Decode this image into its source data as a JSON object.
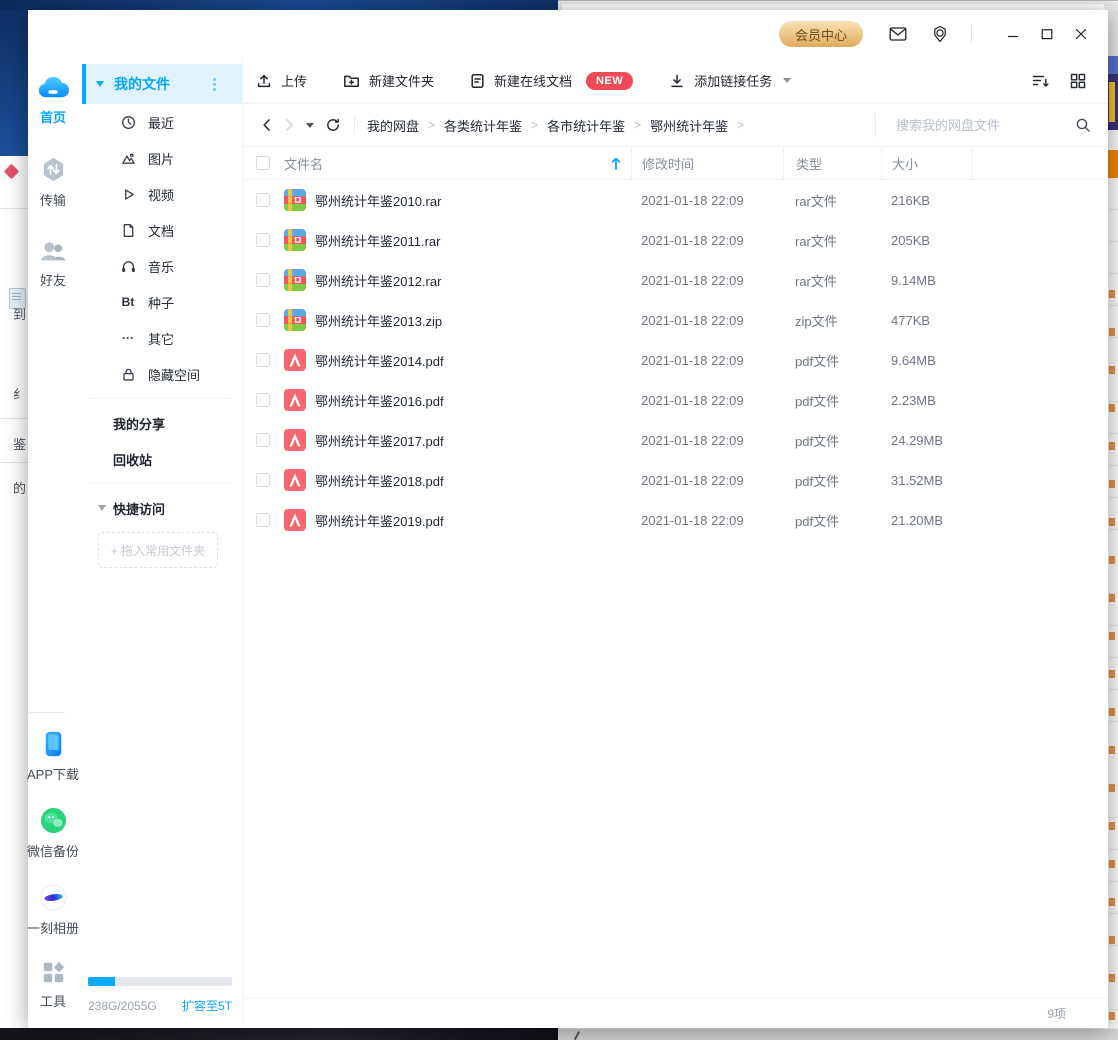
{
  "colors": {
    "accent_blue": "#06a7ff",
    "member_gold_from": "#f8e2b6",
    "member_gold_to": "#e0ab5c",
    "member_text": "#6e4a16",
    "new_badge_red": "#ef4b56",
    "selected_bg": "#e0f3fe",
    "meta_text": "#6f7784"
  },
  "titlebar": {
    "member_center": "会员中心"
  },
  "rail": {
    "items": [
      {
        "label": "首页",
        "icon": "cloud-home-icon",
        "active": true
      },
      {
        "label": "传输",
        "icon": "transfer-icon",
        "active": false
      },
      {
        "label": "好友",
        "icon": "friends-icon",
        "active": false
      }
    ],
    "bottom_items": [
      {
        "label": "APP下载",
        "icon": "phone-app-icon"
      },
      {
        "label": "微信备份",
        "icon": "wechat-backup-icon"
      },
      {
        "label": "一刻相册",
        "icon": "photo-album-icon"
      },
      {
        "label": "工具",
        "icon": "tools-icon"
      }
    ]
  },
  "sidebar": {
    "my_files": "我的文件",
    "items": [
      {
        "label": "最近",
        "icon": "clock-icon"
      },
      {
        "label": "图片",
        "icon": "image-icon"
      },
      {
        "label": "视频",
        "icon": "video-icon"
      },
      {
        "label": "文档",
        "icon": "document-icon"
      },
      {
        "label": "音乐",
        "icon": "music-icon"
      },
      {
        "label": "种子",
        "icon": "bt-icon"
      },
      {
        "label": "其它",
        "icon": "more-dots-icon"
      },
      {
        "label": "隐藏空间",
        "icon": "lock-icon"
      }
    ],
    "icon_glyphs": {
      "bt": "Bt",
      "more": "···"
    },
    "shares": "我的分享",
    "recycle": "回收站",
    "quick_access": "快捷访问",
    "drop_hint": "+ 拖入常用文件夹",
    "storage": {
      "usage": "238G/2055G",
      "upgrade": "扩容至5T",
      "percent": 19
    }
  },
  "toolbar": {
    "upload": "上传",
    "new_folder": "新建文件夹",
    "new_online_doc": "新建在线文档",
    "new_badge": "NEW",
    "add_link_task": "添加链接任务"
  },
  "pathbar": {
    "crumbs": [
      "我的网盘",
      "各类统计年鉴",
      "各市统计年鉴",
      "鄂州统计年鉴"
    ],
    "separator": ">",
    "search_placeholder": "搜索我的网盘文件"
  },
  "table": {
    "columns": {
      "name": "文件名",
      "time": "修改时间",
      "type": "类型",
      "size": "大小"
    },
    "rows": [
      {
        "name": "鄂州统计年鉴2010.rar",
        "time": "2021-01-18 22:09",
        "type": "rar文件",
        "size": "216KB",
        "kind": "rar"
      },
      {
        "name": "鄂州统计年鉴2011.rar",
        "time": "2021-01-18 22:09",
        "type": "rar文件",
        "size": "205KB",
        "kind": "rar"
      },
      {
        "name": "鄂州统计年鉴2012.rar",
        "time": "2021-01-18 22:09",
        "type": "rar文件",
        "size": "9.14MB",
        "kind": "rar"
      },
      {
        "name": "鄂州统计年鉴2013.zip",
        "time": "2021-01-18 22:09",
        "type": "zip文件",
        "size": "477KB",
        "kind": "zip"
      },
      {
        "name": "鄂州统计年鉴2014.pdf",
        "time": "2021-01-18 22:09",
        "type": "pdf文件",
        "size": "9.64MB",
        "kind": "pdf"
      },
      {
        "name": "鄂州统计年鉴2016.pdf",
        "time": "2021-01-18 22:09",
        "type": "pdf文件",
        "size": "2.23MB",
        "kind": "pdf"
      },
      {
        "name": "鄂州统计年鉴2017.pdf",
        "time": "2021-01-18 22:09",
        "type": "pdf文件",
        "size": "24.29MB",
        "kind": "pdf"
      },
      {
        "name": "鄂州统计年鉴2018.pdf",
        "time": "2021-01-18 22:09",
        "type": "pdf文件",
        "size": "31.52MB",
        "kind": "pdf"
      },
      {
        "name": "鄂州统计年鉴2019.pdf",
        "time": "2021-01-18 22:09",
        "type": "pdf文件",
        "size": "21.20MB",
        "kind": "pdf"
      }
    ]
  },
  "statusbar": {
    "count": "9项"
  },
  "background": {
    "left_glyphs": [
      "到",
      "纟",
      "鉴",
      "的"
    ]
  }
}
